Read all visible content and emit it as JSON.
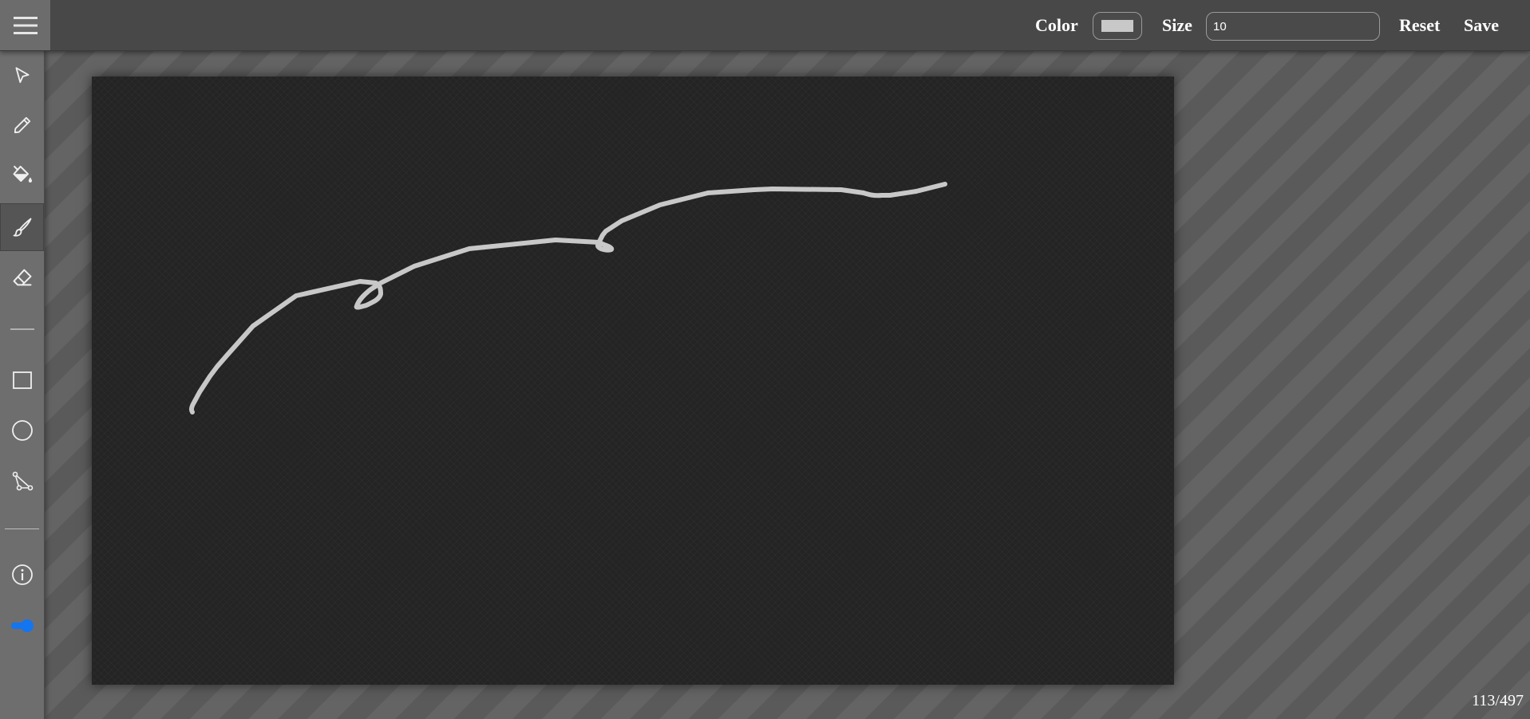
{
  "toolbar": {
    "color_label": "Color",
    "size_label": "Size",
    "size_value": "10",
    "reset_label": "Reset",
    "save_label": "Save",
    "selected_color": "#c8c8c8"
  },
  "tools": [
    {
      "name": "select",
      "icon": "pointer-icon",
      "active": false
    },
    {
      "name": "pencil",
      "icon": "pencil-icon",
      "active": false
    },
    {
      "name": "fill",
      "icon": "paint-bucket-icon",
      "active": false
    },
    {
      "name": "brush",
      "icon": "brush-icon",
      "active": true
    },
    {
      "name": "eraser",
      "icon": "eraser-icon",
      "active": false
    },
    {
      "name": "line",
      "icon": "line-icon",
      "active": false
    },
    {
      "name": "rectangle",
      "icon": "rectangle-icon",
      "active": false
    },
    {
      "name": "circle",
      "icon": "circle-icon",
      "active": false
    },
    {
      "name": "polygon",
      "icon": "polygon-icon",
      "active": false
    },
    {
      "name": "info",
      "icon": "info-icon",
      "active": false
    },
    {
      "name": "toggle",
      "icon": "toggle-icon",
      "active": false
    }
  ],
  "canvas": {
    "background": "#242424",
    "stroke_color": "#c8c8c8"
  },
  "status": {
    "counter": "113/497"
  }
}
